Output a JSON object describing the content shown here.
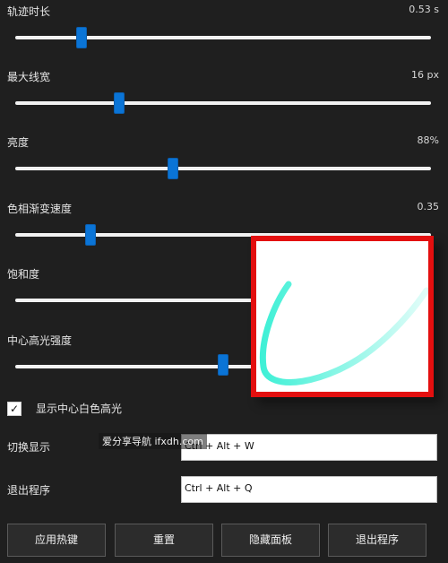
{
  "sliders": [
    {
      "label": "轨迹时长",
      "value": "0.53 s",
      "level": 0.16
    },
    {
      "label": "最大线宽",
      "value": "16 px",
      "level": 0.25
    },
    {
      "label": "亮度",
      "value": "88%",
      "level": 0.38
    },
    {
      "label": "色相渐变速度",
      "value": "0.35",
      "level": 0.18
    },
    {
      "label": "饱和度",
      "value": "",
      "level": 0.65
    },
    {
      "label": "中心高光强度",
      "value": "",
      "level": 0.5
    }
  ],
  "checkbox": {
    "label": "显示中心白色高光",
    "checked": true,
    "mark": "✓"
  },
  "hotkeys": [
    {
      "label": "切换显示",
      "value": "Ctrl + Alt + W"
    },
    {
      "label": "退出程序",
      "value": "Ctrl + Alt + Q"
    }
  ],
  "buttons": [
    "应用热键",
    "重置",
    "隐藏面板",
    "退出程序"
  ],
  "watermark": "爱分享导航 ifxdh.com",
  "preview": {
    "stroke_color": "#3ff0d6",
    "border_color": "#e30f0f"
  }
}
